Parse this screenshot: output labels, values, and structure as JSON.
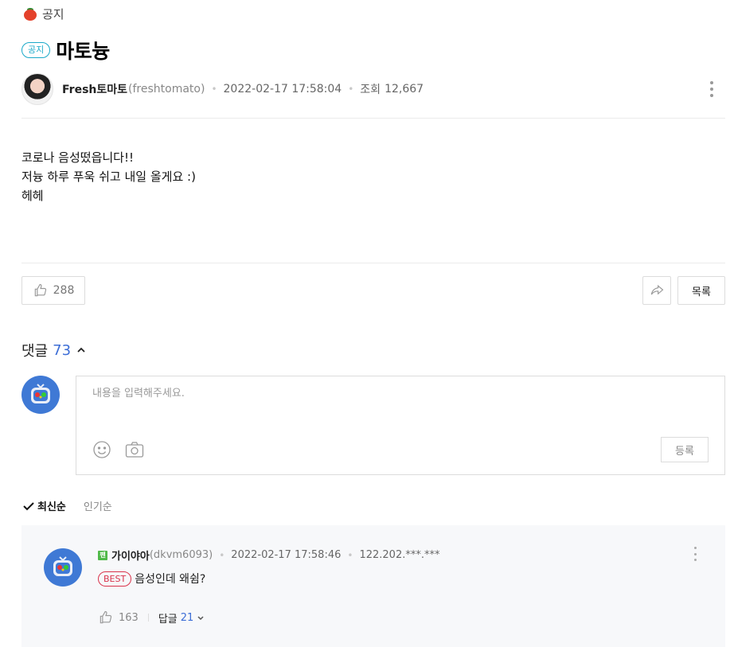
{
  "category": {
    "label": "공지",
    "icon": "tomato-icon"
  },
  "post": {
    "badge": "공지",
    "title": "마토늉",
    "author": {
      "name": "Fresh토마토",
      "id": "(freshtomato)"
    },
    "date": "2022-02-17 17:58:04",
    "views_label": "조회",
    "views": "12,667",
    "body_lines": [
      "코로나 음성떴읍니다!!",
      "저늉 하루 푸욱 쉬고 내일 올게요 :)",
      "헤헤"
    ],
    "likes": "288",
    "list_label": "목록"
  },
  "comments": {
    "label": "댓글",
    "count": "73",
    "input_placeholder": "내용을 입력해주세요.",
    "submit_label": "등록",
    "sort": {
      "latest": "최신순",
      "popular": "인기순"
    },
    "items": [
      {
        "level_badge": "팬",
        "name": "가이야아",
        "id": "(dkvm6093)",
        "date": "2022-02-17 17:58:46",
        "ip": "122.202.***.***",
        "best_label": "BEST",
        "text": "음성인데 왜쉼?",
        "likes": "163",
        "reply_label": "답글",
        "reply_count": "21"
      }
    ]
  },
  "colors": {
    "accent_blue": "#3d6ed6",
    "notice_teal": "#1aa9c9",
    "best_red": "#d9334b",
    "avatar_blue": "#3f79d5"
  }
}
